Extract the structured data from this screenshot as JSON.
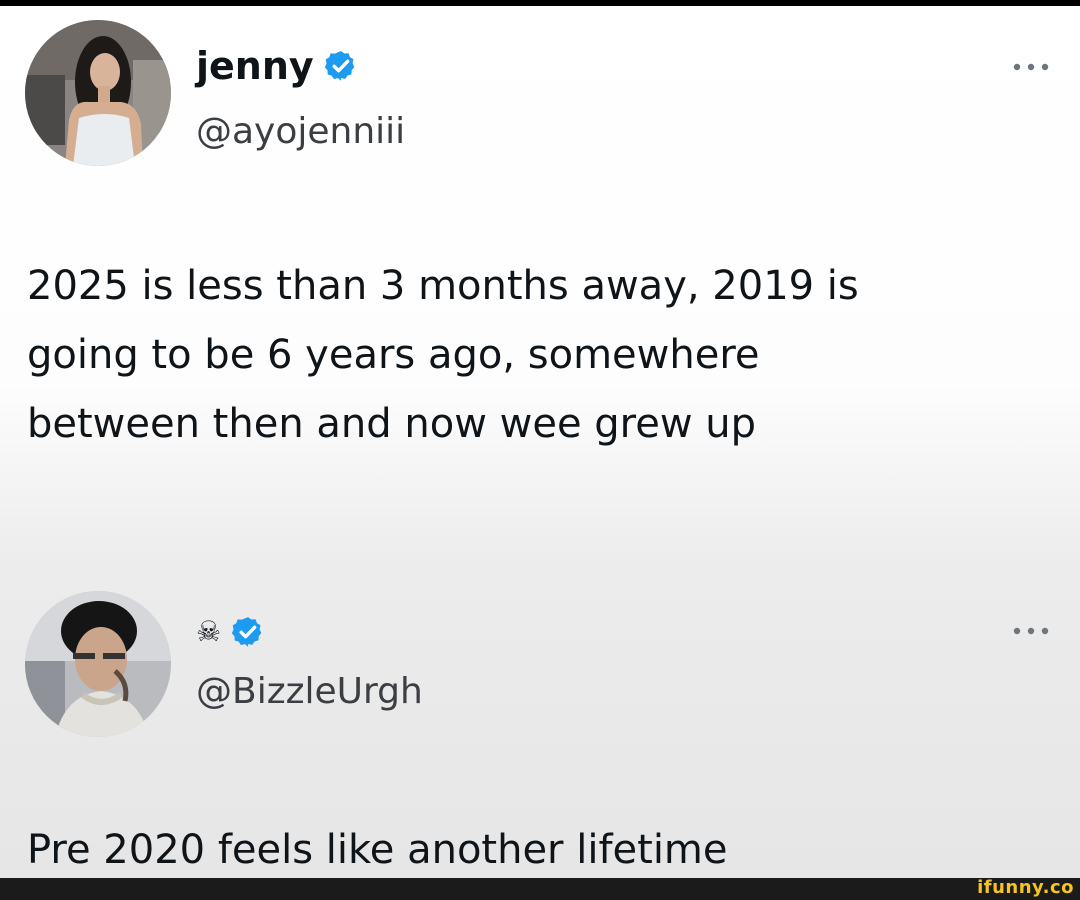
{
  "tweets": [
    {
      "avatar": "jenny-avatar",
      "display_name": "jenny",
      "verified": true,
      "handle": "@ayojenniii",
      "more_icon": "more-horizontal-icon",
      "body_lines": [
        "2025 is less than 3 months away, 2019 is",
        "going to be 6 years ago, somewhere",
        "between then and now wee grew up"
      ]
    },
    {
      "avatar": "bizzle-avatar",
      "display_name": "☠",
      "verified": true,
      "handle": "@BizzleUrgh",
      "more_icon": "more-horizontal-icon",
      "body_lines": [
        "Pre 2020 feels like another lifetime"
      ]
    }
  ],
  "watermark": {
    "text": "ifunny.co"
  },
  "colors": {
    "verified_badge": "#1d9bf0",
    "text": "#0f1419",
    "handle": "#3b3f44",
    "watermark": "#f7c31e",
    "bottom_bar": "#1b1b1b"
  }
}
